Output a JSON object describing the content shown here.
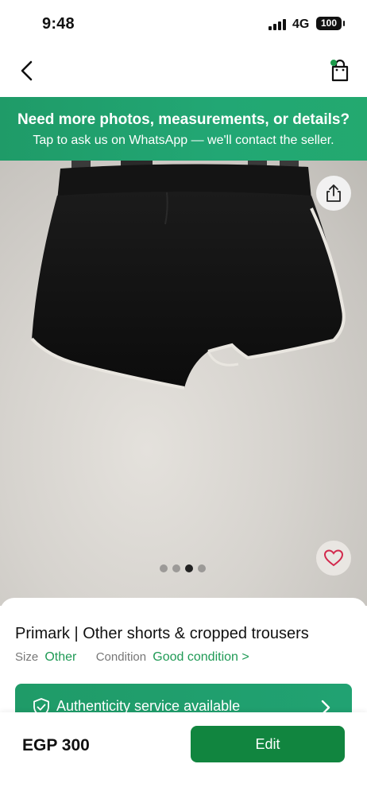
{
  "status_bar": {
    "time": "9:48",
    "network": "4G",
    "battery": "100"
  },
  "nav": {
    "back_icon": "chevron-left-icon",
    "bag_icon": "shopping-bag-icon",
    "bag_dot_color": "#1c9a4a"
  },
  "promo": {
    "title": "Need more photos, measurements, or details?",
    "subtitle": "Tap to ask us on WhatsApp — we'll contact the seller.",
    "background": "#22a774"
  },
  "gallery": {
    "image_count": 4,
    "active_index": 2,
    "share_icon": "share-icon",
    "like_icon": "heart-icon"
  },
  "product": {
    "title": "Primark | Other shorts & cropped trousers",
    "size_label": "Size",
    "size_value": "Other",
    "condition_label": "Condition",
    "condition_value": "Good condition",
    "condition_chevron": ">"
  },
  "authenticity": {
    "label": "Authenticity service available",
    "icon": "shield-check-icon"
  },
  "purchase": {
    "price": "EGP 300",
    "edit_label": "Edit",
    "button_color": "#11853f"
  }
}
